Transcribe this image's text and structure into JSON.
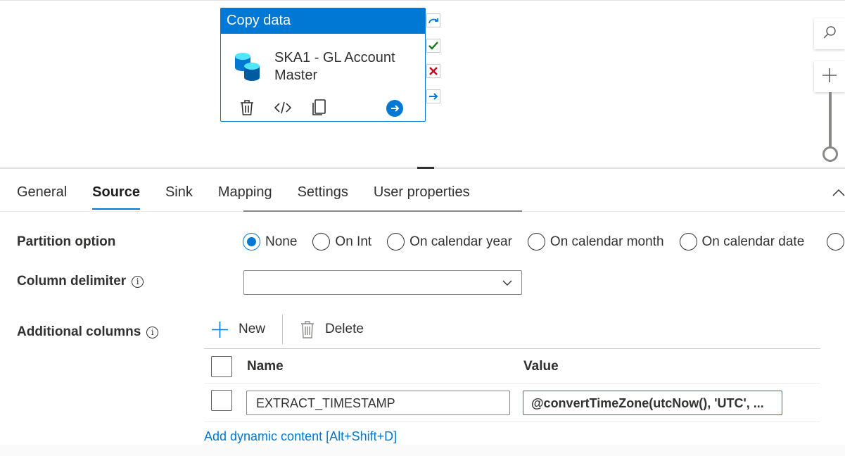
{
  "pipeline": {
    "activity": {
      "type_label": "Copy data",
      "name": "SKA1 - GL Account Master"
    }
  },
  "tabs": [
    {
      "label": "General"
    },
    {
      "label": "Source"
    },
    {
      "label": "Sink"
    },
    {
      "label": "Mapping"
    },
    {
      "label": "Settings"
    },
    {
      "label": "User properties"
    }
  ],
  "active_tab": "Source",
  "form": {
    "partition_option": {
      "label": "Partition option",
      "options": [
        "None",
        "On Int",
        "On calendar year",
        "On calendar month",
        "On calendar date"
      ],
      "selected": "None"
    },
    "column_delimiter": {
      "label": "Column delimiter",
      "info": "i",
      "value": ""
    },
    "additional_columns": {
      "label": "Additional columns",
      "info": "i",
      "toolbar": {
        "new_label": "New",
        "delete_label": "Delete"
      },
      "headers": {
        "name": "Name",
        "value": "Value"
      },
      "rows": [
        {
          "name": "EXTRACT_TIMESTAMP",
          "value": "@convertTimeZone(utcNow(), 'UTC', ..."
        }
      ],
      "dynamic_content_link": "Add dynamic content [Alt+Shift+D]"
    }
  },
  "colors": {
    "accent": "#0078d4",
    "success": "#107c10",
    "failure": "#c50f1f",
    "text": "#323130"
  }
}
